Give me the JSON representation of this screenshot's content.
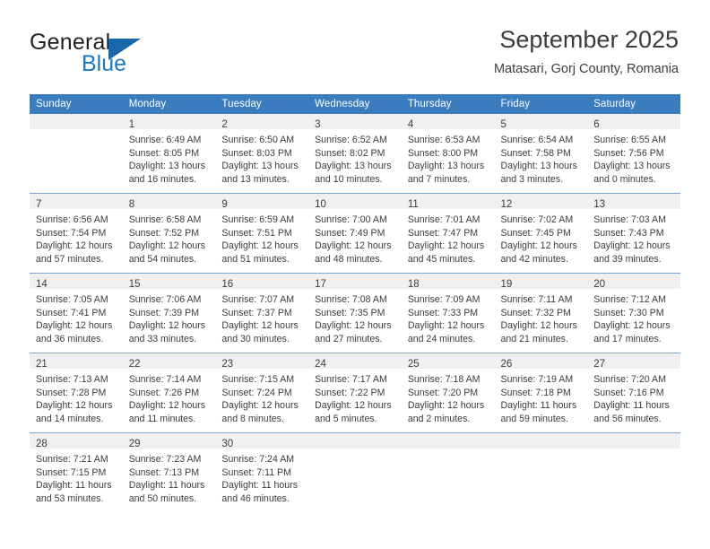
{
  "brand": {
    "name_top": "General",
    "name_bottom": "Blue",
    "triangle_color": "#1866ab",
    "blue_color": "#1b79c3"
  },
  "header": {
    "title": "September 2025",
    "subtitle": "Matasari, Gorj County, Romania"
  },
  "theme": {
    "header_row_bg": "#3a7cbe",
    "header_row_text": "#ffffff",
    "daynum_strip_bg": "#f0f0f0",
    "cell_text": "#3c3c3c",
    "row_divider": "#7aa6d0"
  },
  "weekday_headers": [
    "Sunday",
    "Monday",
    "Tuesday",
    "Wednesday",
    "Thursday",
    "Friday",
    "Saturday"
  ],
  "weeks": [
    [
      {
        "day": "",
        "sunrise": "",
        "sunset": "",
        "daylight_line1": "",
        "daylight_line2": ""
      },
      {
        "day": "1",
        "sunrise": "Sunrise: 6:49 AM",
        "sunset": "Sunset: 8:05 PM",
        "daylight_line1": "Daylight: 13 hours",
        "daylight_line2": "and 16 minutes."
      },
      {
        "day": "2",
        "sunrise": "Sunrise: 6:50 AM",
        "sunset": "Sunset: 8:03 PM",
        "daylight_line1": "Daylight: 13 hours",
        "daylight_line2": "and 13 minutes."
      },
      {
        "day": "3",
        "sunrise": "Sunrise: 6:52 AM",
        "sunset": "Sunset: 8:02 PM",
        "daylight_line1": "Daylight: 13 hours",
        "daylight_line2": "and 10 minutes."
      },
      {
        "day": "4",
        "sunrise": "Sunrise: 6:53 AM",
        "sunset": "Sunset: 8:00 PM",
        "daylight_line1": "Daylight: 13 hours",
        "daylight_line2": "and 7 minutes."
      },
      {
        "day": "5",
        "sunrise": "Sunrise: 6:54 AM",
        "sunset": "Sunset: 7:58 PM",
        "daylight_line1": "Daylight: 13 hours",
        "daylight_line2": "and 3 minutes."
      },
      {
        "day": "6",
        "sunrise": "Sunrise: 6:55 AM",
        "sunset": "Sunset: 7:56 PM",
        "daylight_line1": "Daylight: 13 hours",
        "daylight_line2": "and 0 minutes."
      }
    ],
    [
      {
        "day": "7",
        "sunrise": "Sunrise: 6:56 AM",
        "sunset": "Sunset: 7:54 PM",
        "daylight_line1": "Daylight: 12 hours",
        "daylight_line2": "and 57 minutes."
      },
      {
        "day": "8",
        "sunrise": "Sunrise: 6:58 AM",
        "sunset": "Sunset: 7:52 PM",
        "daylight_line1": "Daylight: 12 hours",
        "daylight_line2": "and 54 minutes."
      },
      {
        "day": "9",
        "sunrise": "Sunrise: 6:59 AM",
        "sunset": "Sunset: 7:51 PM",
        "daylight_line1": "Daylight: 12 hours",
        "daylight_line2": "and 51 minutes."
      },
      {
        "day": "10",
        "sunrise": "Sunrise: 7:00 AM",
        "sunset": "Sunset: 7:49 PM",
        "daylight_line1": "Daylight: 12 hours",
        "daylight_line2": "and 48 minutes."
      },
      {
        "day": "11",
        "sunrise": "Sunrise: 7:01 AM",
        "sunset": "Sunset: 7:47 PM",
        "daylight_line1": "Daylight: 12 hours",
        "daylight_line2": "and 45 minutes."
      },
      {
        "day": "12",
        "sunrise": "Sunrise: 7:02 AM",
        "sunset": "Sunset: 7:45 PM",
        "daylight_line1": "Daylight: 12 hours",
        "daylight_line2": "and 42 minutes."
      },
      {
        "day": "13",
        "sunrise": "Sunrise: 7:03 AM",
        "sunset": "Sunset: 7:43 PM",
        "daylight_line1": "Daylight: 12 hours",
        "daylight_line2": "and 39 minutes."
      }
    ],
    [
      {
        "day": "14",
        "sunrise": "Sunrise: 7:05 AM",
        "sunset": "Sunset: 7:41 PM",
        "daylight_line1": "Daylight: 12 hours",
        "daylight_line2": "and 36 minutes."
      },
      {
        "day": "15",
        "sunrise": "Sunrise: 7:06 AM",
        "sunset": "Sunset: 7:39 PM",
        "daylight_line1": "Daylight: 12 hours",
        "daylight_line2": "and 33 minutes."
      },
      {
        "day": "16",
        "sunrise": "Sunrise: 7:07 AM",
        "sunset": "Sunset: 7:37 PM",
        "daylight_line1": "Daylight: 12 hours",
        "daylight_line2": "and 30 minutes."
      },
      {
        "day": "17",
        "sunrise": "Sunrise: 7:08 AM",
        "sunset": "Sunset: 7:35 PM",
        "daylight_line1": "Daylight: 12 hours",
        "daylight_line2": "and 27 minutes."
      },
      {
        "day": "18",
        "sunrise": "Sunrise: 7:09 AM",
        "sunset": "Sunset: 7:33 PM",
        "daylight_line1": "Daylight: 12 hours",
        "daylight_line2": "and 24 minutes."
      },
      {
        "day": "19",
        "sunrise": "Sunrise: 7:11 AM",
        "sunset": "Sunset: 7:32 PM",
        "daylight_line1": "Daylight: 12 hours",
        "daylight_line2": "and 21 minutes."
      },
      {
        "day": "20",
        "sunrise": "Sunrise: 7:12 AM",
        "sunset": "Sunset: 7:30 PM",
        "daylight_line1": "Daylight: 12 hours",
        "daylight_line2": "and 17 minutes."
      }
    ],
    [
      {
        "day": "21",
        "sunrise": "Sunrise: 7:13 AM",
        "sunset": "Sunset: 7:28 PM",
        "daylight_line1": "Daylight: 12 hours",
        "daylight_line2": "and 14 minutes."
      },
      {
        "day": "22",
        "sunrise": "Sunrise: 7:14 AM",
        "sunset": "Sunset: 7:26 PM",
        "daylight_line1": "Daylight: 12 hours",
        "daylight_line2": "and 11 minutes."
      },
      {
        "day": "23",
        "sunrise": "Sunrise: 7:15 AM",
        "sunset": "Sunset: 7:24 PM",
        "daylight_line1": "Daylight: 12 hours",
        "daylight_line2": "and 8 minutes."
      },
      {
        "day": "24",
        "sunrise": "Sunrise: 7:17 AM",
        "sunset": "Sunset: 7:22 PM",
        "daylight_line1": "Daylight: 12 hours",
        "daylight_line2": "and 5 minutes."
      },
      {
        "day": "25",
        "sunrise": "Sunrise: 7:18 AM",
        "sunset": "Sunset: 7:20 PM",
        "daylight_line1": "Daylight: 12 hours",
        "daylight_line2": "and 2 minutes."
      },
      {
        "day": "26",
        "sunrise": "Sunrise: 7:19 AM",
        "sunset": "Sunset: 7:18 PM",
        "daylight_line1": "Daylight: 11 hours",
        "daylight_line2": "and 59 minutes."
      },
      {
        "day": "27",
        "sunrise": "Sunrise: 7:20 AM",
        "sunset": "Sunset: 7:16 PM",
        "daylight_line1": "Daylight: 11 hours",
        "daylight_line2": "and 56 minutes."
      }
    ],
    [
      {
        "day": "28",
        "sunrise": "Sunrise: 7:21 AM",
        "sunset": "Sunset: 7:15 PM",
        "daylight_line1": "Daylight: 11 hours",
        "daylight_line2": "and 53 minutes."
      },
      {
        "day": "29",
        "sunrise": "Sunrise: 7:23 AM",
        "sunset": "Sunset: 7:13 PM",
        "daylight_line1": "Daylight: 11 hours",
        "daylight_line2": "and 50 minutes."
      },
      {
        "day": "30",
        "sunrise": "Sunrise: 7:24 AM",
        "sunset": "Sunset: 7:11 PM",
        "daylight_line1": "Daylight: 11 hours",
        "daylight_line2": "and 46 minutes."
      },
      {
        "day": "",
        "sunrise": "",
        "sunset": "",
        "daylight_line1": "",
        "daylight_line2": ""
      },
      {
        "day": "",
        "sunrise": "",
        "sunset": "",
        "daylight_line1": "",
        "daylight_line2": ""
      },
      {
        "day": "",
        "sunrise": "",
        "sunset": "",
        "daylight_line1": "",
        "daylight_line2": ""
      },
      {
        "day": "",
        "sunrise": "",
        "sunset": "",
        "daylight_line1": "",
        "daylight_line2": ""
      }
    ]
  ]
}
